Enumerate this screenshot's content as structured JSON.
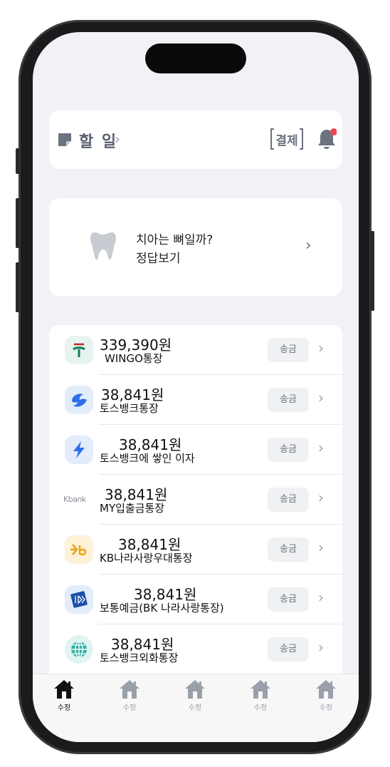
{
  "header": {
    "todo_label": "할 일",
    "pay_label": "결제"
  },
  "quiz": {
    "title": "치아는 뼈일까?",
    "subtitle": "정답보기"
  },
  "accounts": [
    {
      "amount": "339,390원",
      "name": "WINGO통장",
      "send_label": "송금",
      "logo": "wingo-logo-icon"
    },
    {
      "amount": "38,841원",
      "name": "토스뱅크통장",
      "send_label": "송금",
      "logo": "toss-bank-logo-icon"
    },
    {
      "amount": "38,841원",
      "name": "토스뱅크에 쌓인 이자",
      "send_label": "송금",
      "logo": "lightning-icon"
    },
    {
      "amount": "38,841원",
      "name": "MY입출금통장",
      "send_label": "송금",
      "logo": "kbank-logo-icon",
      "logo_text": "Kbank"
    },
    {
      "amount": "38,841원",
      "name": "KB나라사랑우대통장",
      "send_label": "송금",
      "logo": "kb-logo-icon"
    },
    {
      "amount": "38,841원",
      "name": "보통예금(BK 나라사랑통장)",
      "send_label": "송금",
      "logo": "ibk-logo-icon"
    },
    {
      "amount": "38,841원",
      "name": "토스뱅크외화통장",
      "send_label": "송금",
      "logo": "globe-icon"
    }
  ],
  "tabs": [
    {
      "label": "수정",
      "active": true
    },
    {
      "label": "수정",
      "active": false
    },
    {
      "label": "수정",
      "active": false
    },
    {
      "label": "수정",
      "active": false
    },
    {
      "label": "수정",
      "active": false
    }
  ],
  "colors": {
    "background": "#f2f2f6",
    "card": "#ffffff",
    "notification_dot": "#f04452",
    "tab_active": "#111111",
    "tab_inactive": "#9aa0aa"
  }
}
